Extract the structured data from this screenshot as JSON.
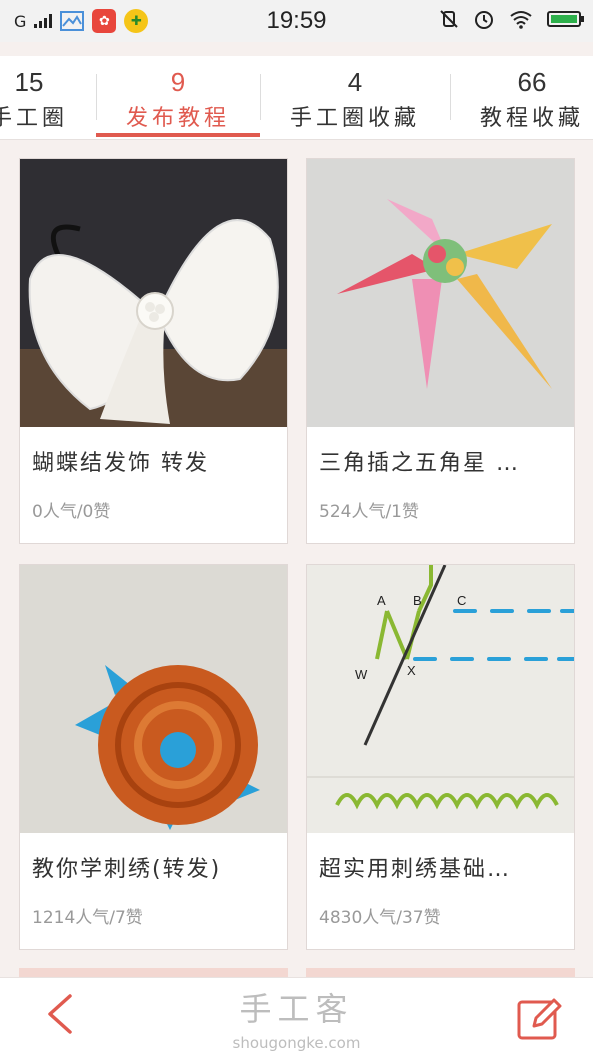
{
  "status_bar": {
    "carrier": "G",
    "time": "19:59",
    "icons": [
      "signal-icon",
      "gallery-icon",
      "app-icon",
      "app-icon",
      "mute-icon",
      "alarm-icon",
      "wifi-icon",
      "battery-icon"
    ]
  },
  "tabs": [
    {
      "count": "15",
      "label": "手工圈"
    },
    {
      "count": "9",
      "label": "发布教程"
    },
    {
      "count": "4",
      "label": "手工圈收藏"
    },
    {
      "count": "66",
      "label": "教程收藏"
    }
  ],
  "active_tab": 1,
  "cards": [
    {
      "title": "蝴蝶结发饰 转发",
      "stats": "0人气/0赞"
    },
    {
      "title": "三角插之五角星 …",
      "stats": "524人气/1赞"
    },
    {
      "title": "教你学刺绣(转发)",
      "stats": "1214人气/7赞"
    },
    {
      "title": "超实用刺绣基础…",
      "stats": "4830人气/37赞"
    }
  ],
  "thumb_labels": {
    "a": "A",
    "b": "B",
    "c": "C",
    "w": "W",
    "x": "X"
  },
  "bottom": {
    "watermark_cn": "手工客",
    "watermark_en": "shougongke.com",
    "back_icon": "back-arrow-icon",
    "edit_icon": "edit-icon"
  },
  "colors": {
    "accent": "#e05a4f",
    "background": "#f6f0ee"
  }
}
